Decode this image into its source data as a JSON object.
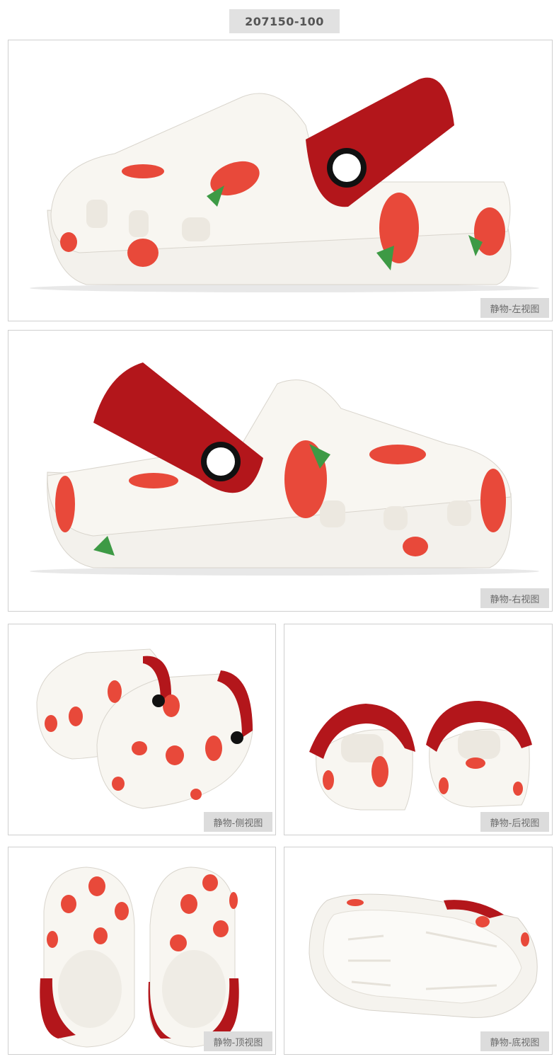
{
  "product": {
    "sku": "207150-100"
  },
  "views": [
    {
      "label": "静物-左视图",
      "icon": "shoe-left-view"
    },
    {
      "label": "静物-右视图",
      "icon": "shoe-right-view"
    },
    {
      "label": "静物-侧视图",
      "icon": "shoe-pair-side-view"
    },
    {
      "label": "静物-后视图",
      "icon": "shoe-pair-back-view"
    },
    {
      "label": "静物-顶视图",
      "icon": "shoe-pair-top-view"
    },
    {
      "label": "静物-底视图",
      "icon": "shoe-bottom-view"
    }
  ],
  "colors": {
    "shoe_body": "#f8f6f1",
    "glitter_strap": "#b3161b",
    "strawberry": "#e8493a",
    "leaf": "#3d9a45",
    "panel_border": "#cfcfcf",
    "tag_background": "#dcdcdc"
  }
}
